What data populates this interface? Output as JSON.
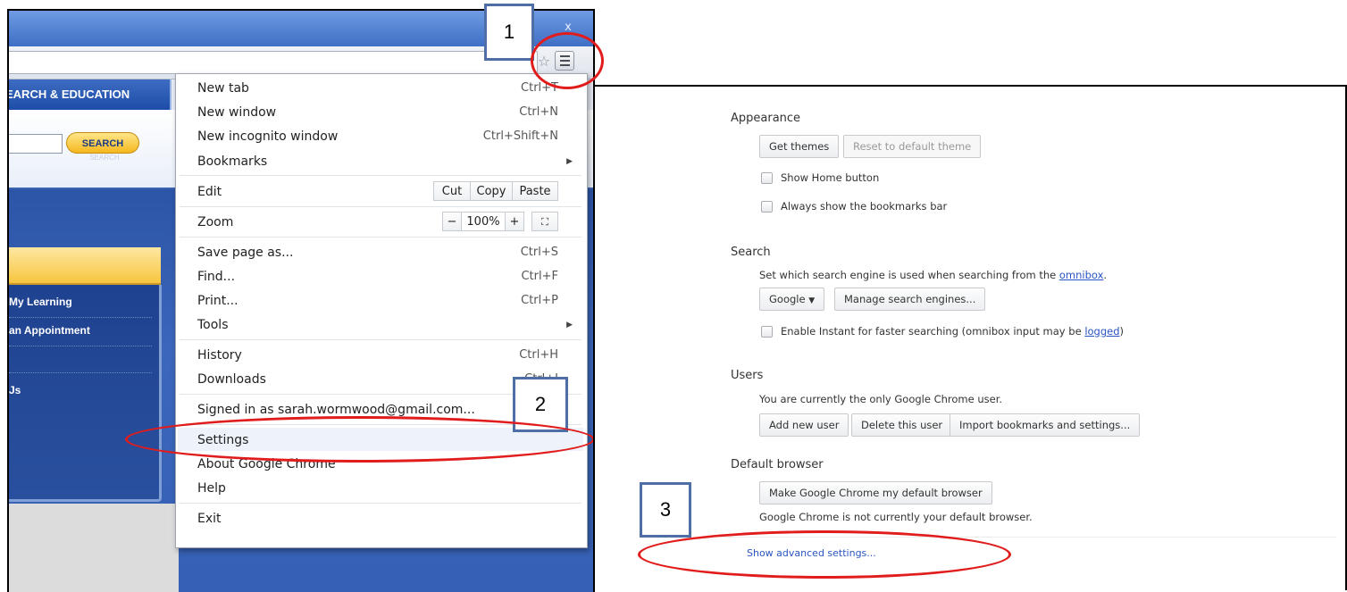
{
  "left": {
    "window_close_glyph": "x",
    "site_nav_label": "EARCH & EDUCATION",
    "search_button": "SEARCH",
    "search_ghost": "SEARCH",
    "side_links": [
      "My Learning",
      "an Appointment",
      "Js"
    ]
  },
  "menu": {
    "new_tab": {
      "label": "New tab",
      "shortcut": "Ctrl+T"
    },
    "new_window": {
      "label": "New window",
      "shortcut": "Ctrl+N"
    },
    "new_incognito": {
      "label": "New incognito window",
      "shortcut": "Ctrl+Shift+N"
    },
    "bookmarks": {
      "label": "Bookmarks"
    },
    "edit": {
      "label": "Edit",
      "cut": "Cut",
      "copy": "Copy",
      "paste": "Paste"
    },
    "zoom": {
      "label": "Zoom",
      "minus": "−",
      "level": "100%",
      "plus": "+"
    },
    "save_page": {
      "label": "Save page as...",
      "shortcut": "Ctrl+S"
    },
    "find": {
      "label": "Find...",
      "shortcut": "Ctrl+F"
    },
    "print": {
      "label": "Print...",
      "shortcut": "Ctrl+P"
    },
    "tools": {
      "label": "Tools"
    },
    "history": {
      "label": "History",
      "shortcut": "Ctrl+H"
    },
    "downloads": {
      "label": "Downloads",
      "shortcut": "Ctrl+J"
    },
    "signed_in": {
      "label": "Signed in as sarah.wormwood@gmail.com..."
    },
    "settings": {
      "label": "Settings"
    },
    "about": {
      "label": "About Google Chrome"
    },
    "help": {
      "label": "Help"
    },
    "exit": {
      "label": "Exit"
    }
  },
  "callouts": {
    "one": "1",
    "two": "2",
    "three": "3"
  },
  "settings": {
    "appearance": {
      "title": "Appearance",
      "get_themes": "Get themes",
      "reset_theme": "Reset to default theme",
      "show_home": "Show Home button",
      "bookmarks_bar": "Always show the bookmarks bar"
    },
    "search": {
      "title": "Search",
      "desc_before": "Set which search engine is used when searching from the ",
      "desc_link": "omnibox",
      "desc_after": ".",
      "engine": "Google",
      "manage": "Manage search engines...",
      "instant_before": "Enable Instant for faster searching (omnibox input may be ",
      "instant_link": "logged",
      "instant_after": ")"
    },
    "users": {
      "title": "Users",
      "desc": "You are currently the only Google Chrome user.",
      "add": "Add new user",
      "delete": "Delete this user",
      "import": "Import bookmarks and settings..."
    },
    "default_browser": {
      "title": "Default browser",
      "make_default": "Make Google Chrome my default browser",
      "status": "Google Chrome is not currently your default browser."
    },
    "advanced_link": "Show advanced settings..."
  },
  "colors": {
    "annotation_red": "#e11c1c",
    "callout_border": "#4e6fa5",
    "link_blue": "#2a54c2"
  }
}
